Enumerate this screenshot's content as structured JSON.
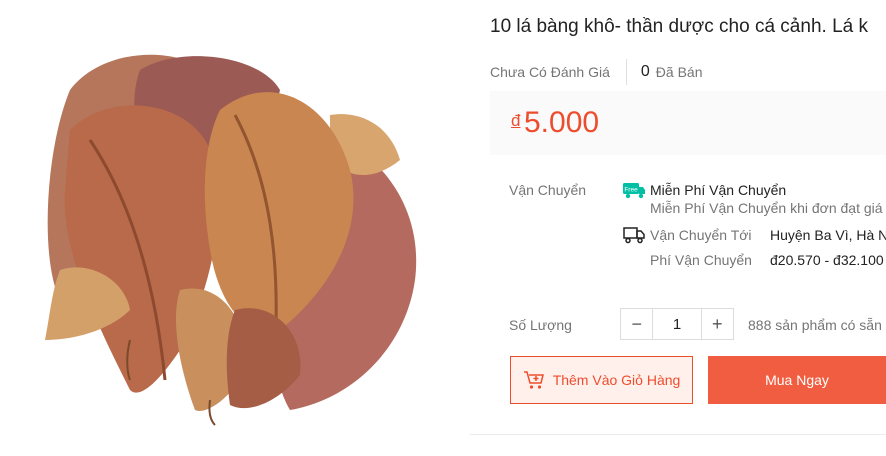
{
  "product": {
    "title": "10 lá bàng khô- thần dược cho cá cảnh. Lá k",
    "rating_text": "Chưa Có Đánh Giá",
    "sold_count": "0",
    "sold_label": "Đã Bán",
    "currency_symbol": "đ",
    "price": "5.000",
    "image_icon": "dried-leaves-image"
  },
  "shipping": {
    "label": "Vận Chuyển",
    "free_badge": "Free",
    "free_title": "Miễn Phí Vận Chuyển",
    "free_desc": "Miễn Phí Vận Chuyển khi đơn đạt giá",
    "to_label": "Vận Chuyển Tới",
    "to_value": "Huyện Ba Vì, Hà N",
    "fee_label": "Phí Vận Chuyển",
    "fee_value": "đ20.570 - đ32.100",
    "truck_icon": "truck-icon"
  },
  "quantity": {
    "label": "Số Lượng",
    "minus": "−",
    "value": "1",
    "plus": "+",
    "stock_text": "888 sản phẩm có sẵn"
  },
  "actions": {
    "add_to_cart_label": "Thêm Vào Giỏ Hàng",
    "buy_now_label": "Mua Ngay"
  },
  "colors": {
    "accent": "#ee4d2d",
    "buy_button": "#f05d40",
    "free_badge": "#00bfa5"
  }
}
